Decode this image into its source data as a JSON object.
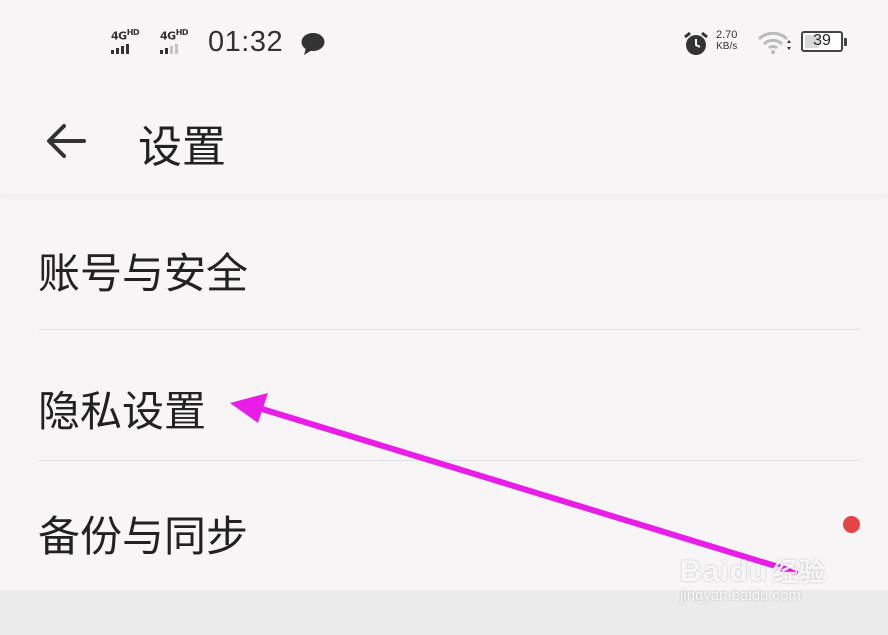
{
  "status_bar": {
    "sim1_label": "4G",
    "sim1_sup": "HD",
    "sim2_label": "4G",
    "sim2_sup": "HD",
    "time": "01:32",
    "net_speed_value": "2.70",
    "net_speed_unit": "KB/s",
    "battery_level": "39",
    "icons": [
      "message-icon",
      "alarm-icon",
      "wifi-icon",
      "battery-icon"
    ]
  },
  "header": {
    "title": "设置",
    "back_icon": "arrow-left-icon"
  },
  "menu": {
    "items": [
      {
        "label": "账号与安全"
      },
      {
        "label": "隐私设置"
      },
      {
        "label": "备份与同步",
        "badge_color": "#e54346"
      }
    ]
  },
  "annotation": {
    "arrow_color": "#e81ee8",
    "points_to": "隐私设置"
  },
  "watermark": {
    "logo": "Baidu",
    "brand": "经验",
    "url": "jingyan.baidu.com"
  }
}
